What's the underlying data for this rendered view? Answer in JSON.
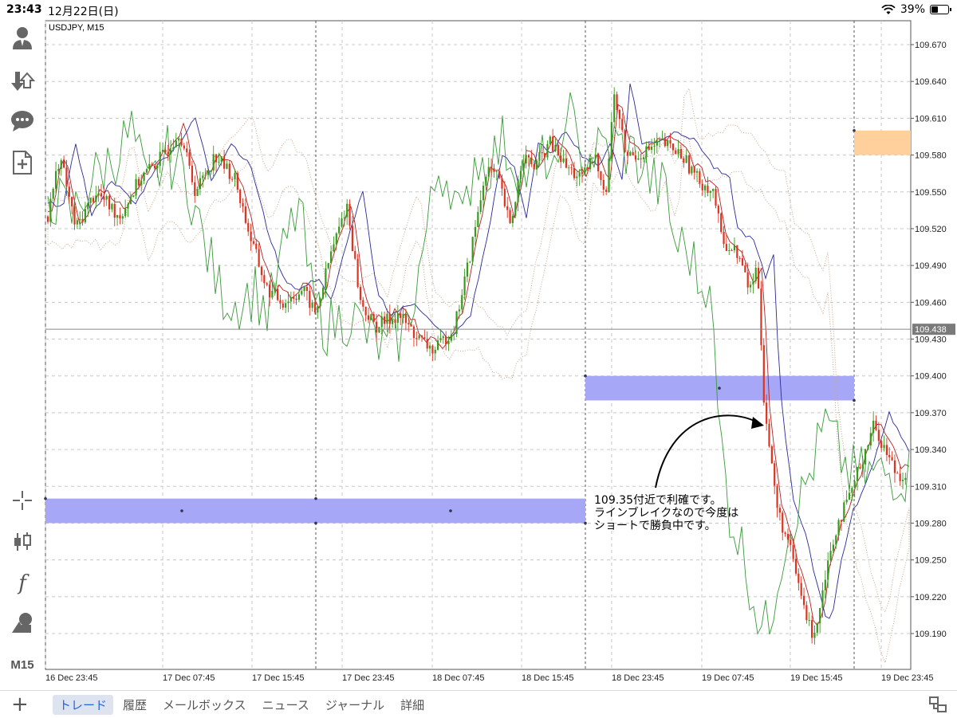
{
  "status": {
    "time": "23:43",
    "date": "12月22日(日)",
    "battery": "39%"
  },
  "toolbar": {
    "items": [
      {
        "icon": "account-icon"
      },
      {
        "icon": "trade-arrows-icon"
      },
      {
        "icon": "chat-icon"
      },
      {
        "icon": "new-order-icon"
      },
      {
        "icon": "crosshair-icon"
      },
      {
        "icon": "candlestick-icon"
      },
      {
        "icon": "indicators-icon",
        "label": "f"
      },
      {
        "icon": "objects-icon"
      },
      {
        "icon": "timeframe-icon",
        "label": "M15"
      }
    ]
  },
  "chart": {
    "symbol": "USDJPY, M15",
    "current_price": "109.438",
    "price_ticks": [
      "109.670",
      "109.640",
      "109.610",
      "109.580",
      "109.550",
      "109.520",
      "109.490",
      "109.460",
      "109.430",
      "109.400",
      "109.370",
      "109.340",
      "109.310",
      "109.280",
      "109.250",
      "109.220",
      "109.190"
    ],
    "time_ticks": [
      "16 Dec 23:45",
      "17 Dec 07:45",
      "17 Dec 15:45",
      "17 Dec 23:45",
      "18 Dec 07:45",
      "18 Dec 15:45",
      "18 Dec 23:45",
      "19 Dec 07:45",
      "19 Dec 15:45",
      "19 Dec 23:45"
    ],
    "annotation_lines": [
      "109.35付近で利確です。",
      "ラインブレイクなので今度は",
      "ショートで勝負中です。"
    ],
    "colors": {
      "bull": "#3a9a1e",
      "bear": "#e0331f",
      "zone_blue": "#a7a7f7",
      "zone_orange": "#ffd09c",
      "tenkan": "#b22222",
      "kijun": "#2a2a9a",
      "chikou": "#3a9a3a",
      "cloud": "#c9a589"
    }
  },
  "bottom": {
    "add_label": "+",
    "tabs": [
      "トレード",
      "履歴",
      "メールボックス",
      "ニュース",
      "ジャーナル",
      "詳細"
    ],
    "active_tab": 0
  }
}
